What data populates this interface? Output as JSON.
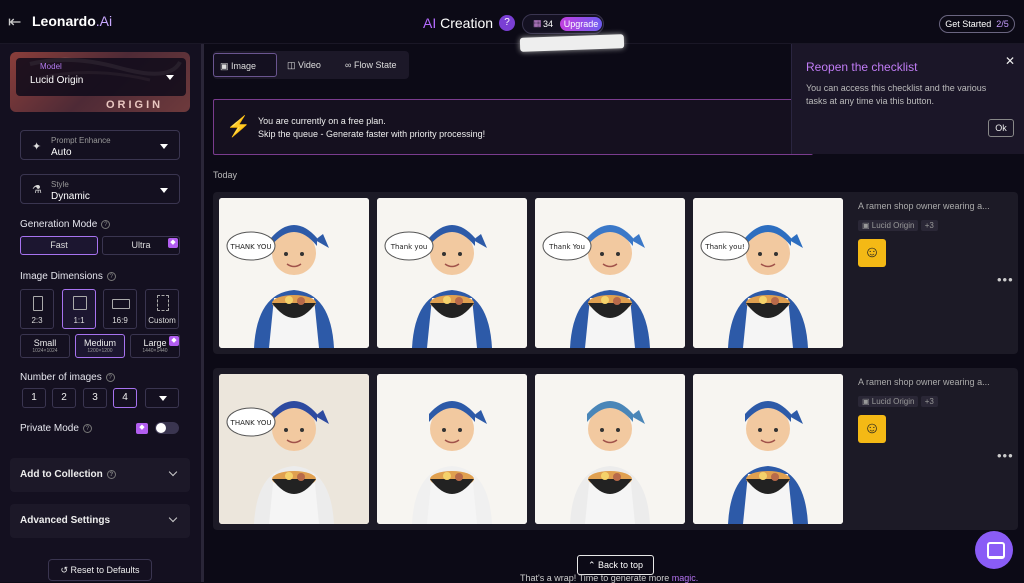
{
  "topbar": {
    "brand": "Leonardo",
    "brand_suffix": ".Ai",
    "title_prefix": "AI",
    "title": " Creation",
    "help": "?",
    "token_count": "34",
    "upgrade": "Upgrade",
    "get_started": "Get Started",
    "get_started_progress": "2/5"
  },
  "sidebar": {
    "model_label": "Model",
    "model_value": "Lucid Origin",
    "model_image_text": "ORIGIN",
    "prompt_enhance_label": "Prompt Enhance",
    "prompt_enhance_value": "Auto",
    "style_label": "Style",
    "style_value": "Dynamic",
    "generation_mode_title": "Generation Mode",
    "mode_fast": "Fast",
    "mode_ultra": "Ultra",
    "image_dimensions_title": "Image Dimensions",
    "aspects": [
      "2:3",
      "1:1",
      "16:9",
      "Custom"
    ],
    "sizes": [
      {
        "label": "Small",
        "dims": "1024×1024"
      },
      {
        "label": "Medium",
        "dims": "1200×1200"
      },
      {
        "label": "Large",
        "dims": "1440×1440"
      }
    ],
    "num_images_title": "Number of images",
    "num_options": [
      "1",
      "2",
      "3",
      "4"
    ],
    "private_mode": "Private Mode",
    "add_to_collection": "Add to Collection",
    "advanced_settings": "Advanced Settings",
    "reset": "Reset to Defaults"
  },
  "main": {
    "tabs": [
      "Image",
      "Video",
      "Flow State"
    ],
    "banner_line1": "You are currently on a free plan.",
    "banner_line2": "Skip the queue - Generate faster with priority processing!",
    "today": "Today",
    "generations": [
      {
        "description": "A ramen shop owner wearing a...",
        "model": "Lucid Origin",
        "extra": "+3"
      },
      {
        "description": "A ramen shop owner wearing a...",
        "model": "Lucid Origin",
        "extra": "+3"
      }
    ],
    "back_to_top": "Back to top",
    "wrap_text": "That's a wrap! Time to generate more ",
    "wrap_link": "magic."
  },
  "popup": {
    "title": "Reopen the checklist",
    "body": "You can access this checklist and the various tasks at any time via this button.",
    "ok": "Ok"
  },
  "thumbnails": {
    "row1": [
      {
        "speech": "THANK YOU",
        "bandana": "#2d5aa8",
        "shirt": "#2d5aa8"
      },
      {
        "speech": "Thank you",
        "bandana": "#2d5aa8",
        "shirt": "#2d5aa8"
      },
      {
        "speech": "Thank You",
        "bandana": "#3b78c8",
        "shirt": "#2d5aa8"
      },
      {
        "speech": "Thank you!",
        "bandana": "#2d6ec0",
        "shirt": "#2d5aa8"
      }
    ],
    "row2": [
      {
        "speech": "THANK YOU",
        "bandana": "#2d4aa0",
        "shirt": "#ececec"
      },
      {
        "speech": "",
        "bandana": "#2d5aa8",
        "shirt": "#f0f0f0"
      },
      {
        "speech": "",
        "bandana": "#4a86b8",
        "shirt": "#ececec"
      },
      {
        "speech": "",
        "bandana": "#2d5aa8",
        "shirt": "#2d5aa8"
      }
    ]
  }
}
